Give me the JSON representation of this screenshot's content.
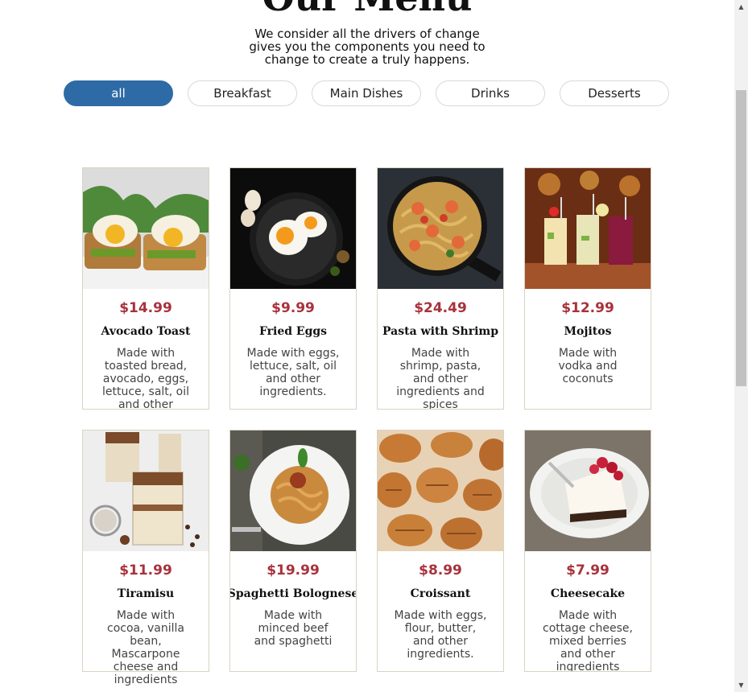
{
  "page": {
    "title": "Our Menu",
    "intro": "We consider all the drivers of change gives you the components you need to change to create a truly happens."
  },
  "filters": [
    "all",
    "Breakfast",
    "Main Dishes",
    "Drinks",
    "Desserts"
  ],
  "active_filter": "all",
  "colors": {
    "accent": "#2e6ba6",
    "price": "#a8323c",
    "card_border": "#d9d3c3"
  },
  "items": [
    {
      "price": "$14.99",
      "name": "Avocado Toast",
      "desc": "Made with toasted bread, avocado, eggs, lettuce, salt, oil and other ingredients.",
      "image": "avocado-toast-photo"
    },
    {
      "price": "$9.99",
      "name": "Fried Eggs",
      "desc": "Made with eggs, lettuce, salt, oil and other ingredients.",
      "image": "fried-eggs-photo"
    },
    {
      "price": "$24.49",
      "name": "Pasta with Shrimp",
      "desc": "Made with shrimp, pasta, and other ingredients and spices",
      "image": "pasta-shrimp-photo"
    },
    {
      "price": "$12.99",
      "name": "Mojitos",
      "desc": "Made with vodka and coconuts",
      "image": "mojitos-photo"
    },
    {
      "price": "$11.99",
      "name": "Tiramisu",
      "desc": "Made with cocoa, vanilla bean, Mascarpone cheese and other",
      "image": "tiramisu-photo"
    },
    {
      "price": "$19.99",
      "name": "Spaghetti Bolognese",
      "desc": "Made with minced beef and spaghetti",
      "image": "spaghetti-photo"
    },
    {
      "price": "$8.99",
      "name": "Croissant",
      "desc": "Made with eggs, flour, butter, and other ingredients.",
      "image": "croissant-photo"
    },
    {
      "price": "$7.99",
      "name": "Cheesecake",
      "desc": "Made with cottage cheese, mixed berries and other ingredients",
      "image": "cheesecake-photo"
    }
  ],
  "overflow_text": "ingredients",
  "scrollbar": {
    "up_icon": "scroll-up-arrow-icon",
    "down_icon": "scroll-down-arrow-icon"
  }
}
